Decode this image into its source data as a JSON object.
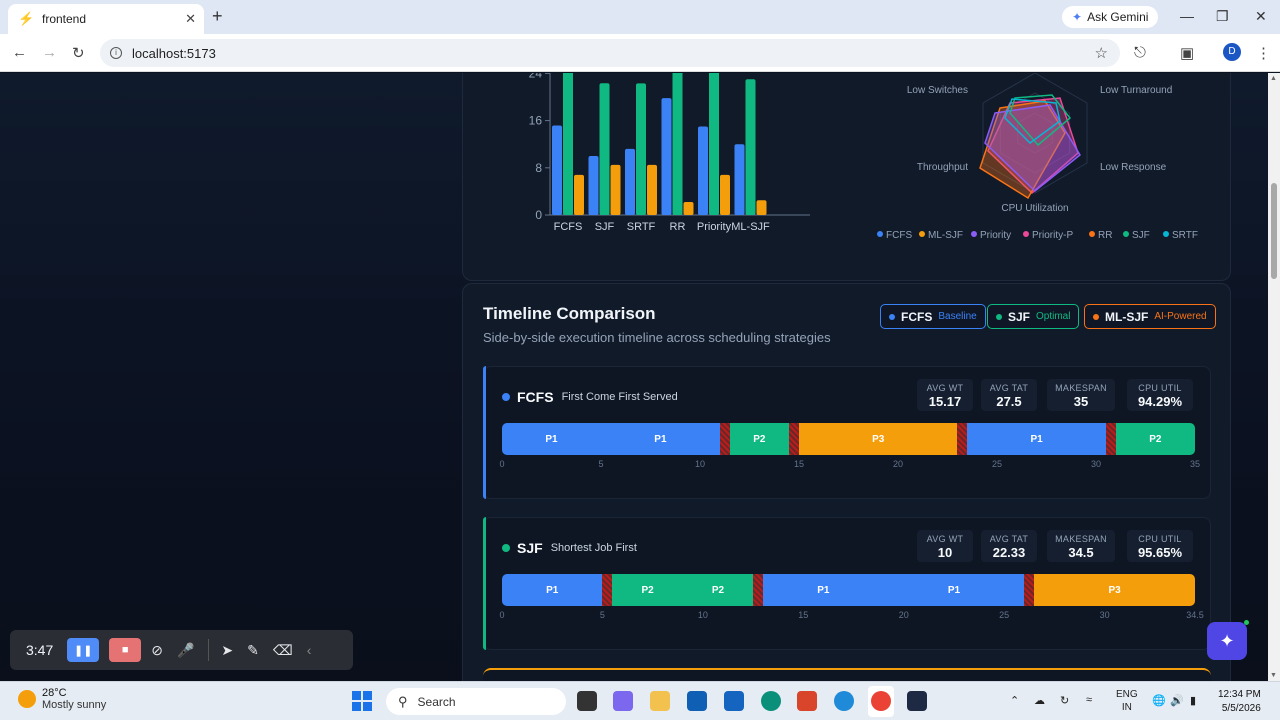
{
  "browser": {
    "tab_title": "frontend",
    "gemini_label": "Ask Gemini",
    "url": "localhost:5173",
    "avatar_letter": "D"
  },
  "top_chart": {
    "chart_data": {
      "type": "bar",
      "categories": [
        "FCFS",
        "SJF",
        "SRTF",
        "RR",
        "Priority",
        "ML-SJF"
      ],
      "series": [
        {
          "color": "#3b82f6",
          "values": [
            15.17,
            10,
            11.2,
            19.8,
            15,
            12
          ]
        },
        {
          "color": "#10b981",
          "values": [
            27.5,
            22.33,
            22.3,
            26,
            27.5,
            23
          ]
        },
        {
          "color": "#f59e0b",
          "values": [
            6.8,
            8.5,
            8.5,
            2.2,
            6.8,
            2.5
          ]
        }
      ],
      "yticks": [
        "0",
        "8",
        "16",
        "24"
      ],
      "ylim": [
        0,
        24
      ],
      "grid": false
    },
    "radar": {
      "axes": [
        "Low Turnaround",
        "Low Response",
        "CPU Utilization",
        "Throughput",
        "Low Switches"
      ],
      "legend": [
        {
          "name": "FCFS",
          "color": "#3b82f6"
        },
        {
          "name": "ML-SJF",
          "color": "#f59e0b"
        },
        {
          "name": "Priority",
          "color": "#8b5cf6"
        },
        {
          "name": "Priority-P",
          "color": "#ec4899"
        },
        {
          "name": "RR",
          "color": "#f97316"
        },
        {
          "name": "SJF",
          "color": "#10b981"
        },
        {
          "name": "SRTF",
          "color": "#06b6d4"
        }
      ]
    }
  },
  "timeline": {
    "title": "Timeline Comparison",
    "subtitle": "Side-by-side execution timeline across scheduling strategies",
    "chips": [
      {
        "label": "FCFS",
        "tag": "Baseline",
        "color": "#3b82f6"
      },
      {
        "label": "SJF",
        "tag": "Optimal",
        "color": "#10b981"
      },
      {
        "label": "ML-SJF",
        "tag": "AI-Powered",
        "color": "#f97316"
      }
    ],
    "stat_labels": [
      "AVG WT",
      "AVG TAT",
      "MAKESPAN",
      "CPU UTIL"
    ],
    "algorithms": [
      {
        "name": "FCFS",
        "full": "First Come First Served",
        "color": "#3b82f6",
        "stats": [
          "15.17",
          "27.5",
          "35",
          "94.29%"
        ],
        "makespan": 35,
        "segments": [
          {
            "label": "P1",
            "start": 0,
            "end": 5,
            "color": "#3b82f6"
          },
          {
            "label": "P1",
            "start": 5,
            "end": 11,
            "color": "#3b82f6"
          },
          {
            "label": "",
            "start": 11,
            "end": 11.5,
            "ctx": true
          },
          {
            "label": "P2",
            "start": 11.5,
            "end": 14.5,
            "color": "#10b981"
          },
          {
            "label": "",
            "start": 14.5,
            "end": 15,
            "ctx": true
          },
          {
            "label": "P3",
            "start": 15,
            "end": 23,
            "color": "#f59e0b"
          },
          {
            "label": "",
            "start": 23,
            "end": 23.5,
            "ctx": true
          },
          {
            "label": "P1",
            "start": 23.5,
            "end": 30.5,
            "color": "#3b82f6"
          },
          {
            "label": "",
            "start": 30.5,
            "end": 31,
            "ctx": true
          },
          {
            "label": "P2",
            "start": 31,
            "end": 35,
            "color": "#10b981"
          }
        ],
        "ticks": [
          "0",
          "5",
          "10",
          "15",
          "20",
          "25",
          "30",
          "35"
        ]
      },
      {
        "name": "SJF",
        "full": "Shortest Job First",
        "color": "#10b981",
        "stats": [
          "10",
          "22.33",
          "34.5",
          "95.65%"
        ],
        "makespan": 34.5,
        "segments": [
          {
            "label": "P1",
            "start": 0,
            "end": 5,
            "color": "#3b82f6"
          },
          {
            "label": "",
            "start": 5,
            "end": 5.5,
            "ctx": true
          },
          {
            "label": "P2",
            "start": 5.5,
            "end": 9,
            "color": "#10b981"
          },
          {
            "label": "P2",
            "start": 9,
            "end": 12.5,
            "color": "#10b981"
          },
          {
            "label": "",
            "start": 12.5,
            "end": 13,
            "ctx": true
          },
          {
            "label": "P1",
            "start": 13,
            "end": 19,
            "color": "#3b82f6"
          },
          {
            "label": "P1",
            "start": 19,
            "end": 26,
            "color": "#3b82f6"
          },
          {
            "label": "",
            "start": 26,
            "end": 26.5,
            "ctx": true
          },
          {
            "label": "P3",
            "start": 26.5,
            "end": 34.5,
            "color": "#f59e0b"
          }
        ],
        "ticks": [
          "0",
          "5",
          "10",
          "15",
          "20",
          "25",
          "30",
          "34.5"
        ]
      }
    ]
  },
  "recorder": {
    "time": "3:47"
  },
  "taskbar": {
    "temp": "28°C",
    "weather": "Mostly sunny",
    "search": "Search",
    "lang1": "ENG",
    "lang2": "IN",
    "time": "12:34 PM",
    "date": "5/5/2026"
  }
}
